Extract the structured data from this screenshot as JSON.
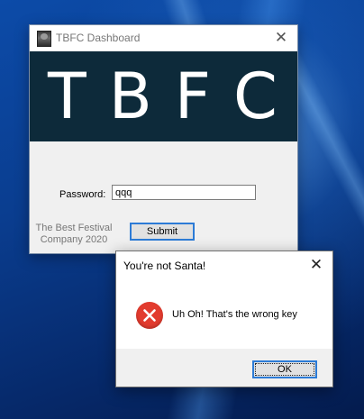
{
  "main_window": {
    "title": "TBFC Dashboard",
    "banner_text": "TBFC",
    "password_label": "Password:",
    "password_value": "qqq",
    "company_text": "The Best Festival Company 2020",
    "submit_label": "Submit"
  },
  "dialog": {
    "title": "You're not Santa!",
    "message": "Uh Oh! That's the wrong key",
    "ok_label": "OK",
    "icon": "error-icon"
  },
  "colors": {
    "banner_bg": "#0d2a3a",
    "error_red": "#e23b2e",
    "focus_blue": "#2c7bd6",
    "desktop_blue": "#0a3a86"
  }
}
